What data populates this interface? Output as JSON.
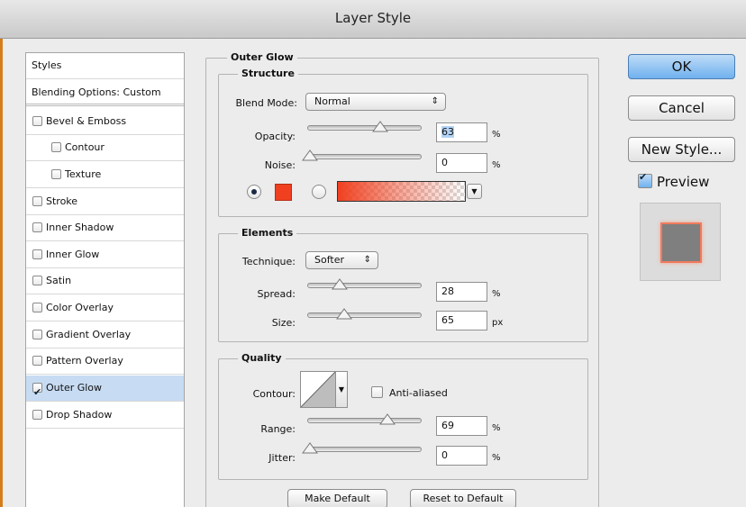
{
  "window": {
    "title": "Layer Style"
  },
  "styles_list": [
    {
      "label": "Styles",
      "type": "header"
    },
    {
      "label": "Blending Options: Custom",
      "type": "header"
    },
    {
      "label": "Bevel & Emboss",
      "checked": false
    },
    {
      "label": "Contour",
      "checked": false,
      "sub": true
    },
    {
      "label": "Texture",
      "checked": false,
      "sub": true
    },
    {
      "label": "Stroke",
      "checked": false
    },
    {
      "label": "Inner Shadow",
      "checked": false
    },
    {
      "label": "Inner Glow",
      "checked": false
    },
    {
      "label": "Satin",
      "checked": false
    },
    {
      "label": "Color Overlay",
      "checked": false
    },
    {
      "label": "Gradient Overlay",
      "checked": false
    },
    {
      "label": "Pattern Overlay",
      "checked": false
    },
    {
      "label": "Outer Glow",
      "checked": true,
      "selected": true
    },
    {
      "label": "Drop Shadow",
      "checked": false
    }
  ],
  "panel": {
    "title": "Outer Glow"
  },
  "structure": {
    "title": "Structure",
    "blend_mode_label": "Blend Mode:",
    "blend_mode_value": "Normal",
    "opacity_label": "Opacity:",
    "opacity_value": "63",
    "opacity_unit": "%",
    "noise_label": "Noise:",
    "noise_value": "0",
    "noise_unit": "%",
    "color_swatch": "#f0401f",
    "gradient_start": "#f0401f"
  },
  "elements": {
    "title": "Elements",
    "technique_label": "Technique:",
    "technique_value": "Softer",
    "spread_label": "Spread:",
    "spread_value": "28",
    "spread_unit": "%",
    "size_label": "Size:",
    "size_value": "65",
    "size_unit": "px"
  },
  "quality": {
    "title": "Quality",
    "contour_label": "Contour:",
    "anti_aliased_label": "Anti-aliased",
    "anti_aliased_checked": false,
    "range_label": "Range:",
    "range_value": "69",
    "range_unit": "%",
    "jitter_label": "Jitter:",
    "jitter_value": "0",
    "jitter_unit": "%"
  },
  "buttons": {
    "make_default": "Make Default",
    "reset_default": "Reset to Default",
    "ok": "OK",
    "cancel": "Cancel",
    "new_style": "New Style...",
    "preview_label": "Preview",
    "preview_checked": true
  },
  "colors": {
    "accent_ok": "#6fb1ee",
    "selection": "#c7dcf3",
    "glow": "#f0401f"
  }
}
